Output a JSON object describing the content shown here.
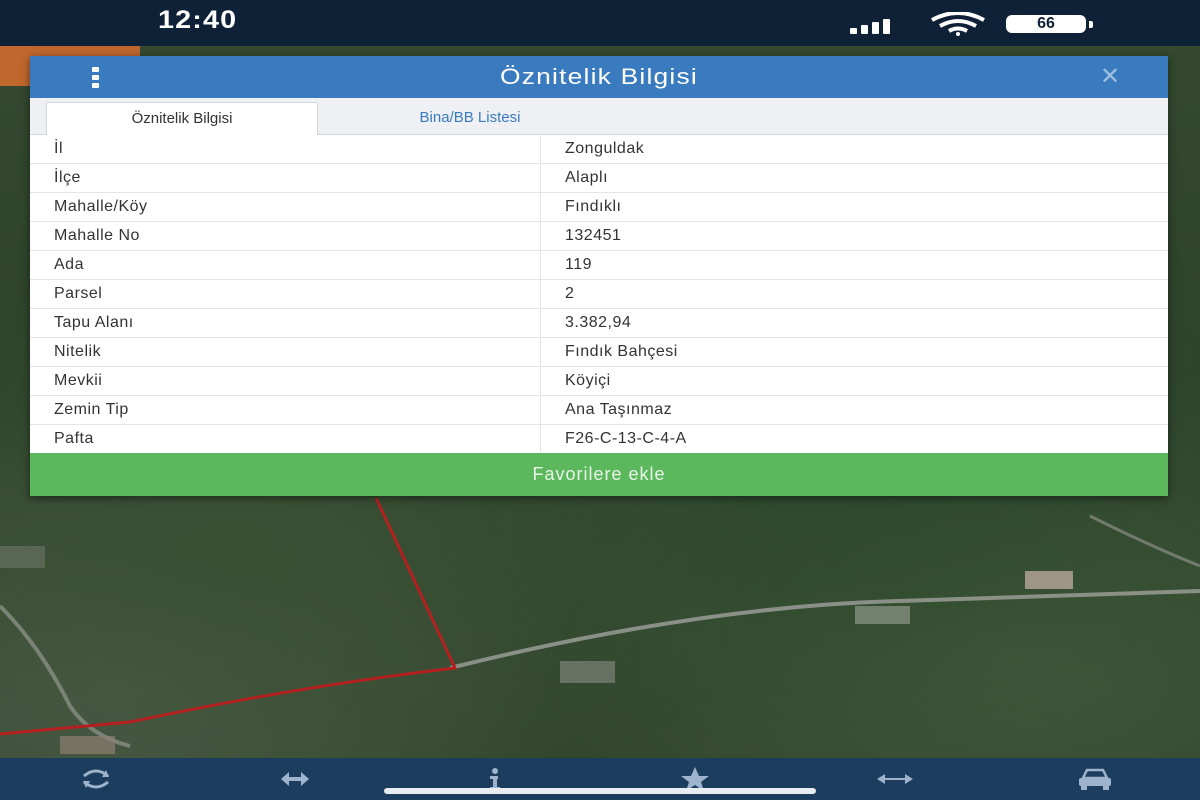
{
  "status_bar": {
    "time": "12:40",
    "battery": "66",
    "icons": [
      "signal-icon",
      "wifi-icon",
      "battery-icon"
    ]
  },
  "modal": {
    "title": "Öznitelik Bilgisi",
    "icons": {
      "menu": "menu-dots-icon",
      "close": "close-icon"
    },
    "tabs": [
      {
        "label": "Öznitelik Bilgisi",
        "active": true
      },
      {
        "label": "Bina/BB Listesi",
        "active": false
      }
    ],
    "rows": [
      {
        "key": "İl",
        "value": "Zonguldak"
      },
      {
        "key": "İlçe",
        "value": "Alaplı"
      },
      {
        "key": "Mahalle/Köy",
        "value": "Fındıklı"
      },
      {
        "key": "Mahalle No",
        "value": "132451"
      },
      {
        "key": "Ada",
        "value": "119"
      },
      {
        "key": "Parsel",
        "value": "2"
      },
      {
        "key": "Tapu Alanı",
        "value": "3.382,94"
      },
      {
        "key": "Nitelik",
        "value": "Fındık Bahçesi"
      },
      {
        "key": "Mevkii",
        "value": "Köyiçi"
      },
      {
        "key": "Zemin Tip",
        "value": "Ana Taşınmaz"
      },
      {
        "key": "Pafta",
        "value": "F26-C-13-C-4-A"
      }
    ],
    "favorite_button": "Favorilere ekle"
  },
  "toolbar": {
    "icons": [
      "refresh-icon",
      "move-icon",
      "info-icon",
      "star-icon",
      "measure-icon",
      "car-icon"
    ]
  },
  "colors": {
    "header": "#3a7bbf",
    "favorite_button": "#5cb85c",
    "parcel_line": "#b32020",
    "toolbar": "#1c3d5e"
  }
}
